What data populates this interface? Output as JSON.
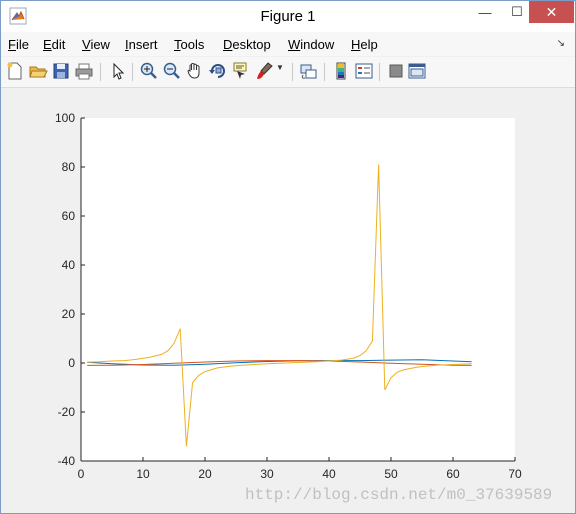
{
  "window": {
    "title": "Figure 1",
    "minimize_glyph": "—",
    "maximize_glyph": "☐",
    "close_glyph": "✕"
  },
  "menu": {
    "items": [
      {
        "label": "File",
        "mnemonic": "F",
        "rest": "ile"
      },
      {
        "label": "Edit",
        "mnemonic": "E",
        "rest": "dit"
      },
      {
        "label": "View",
        "mnemonic": "V",
        "rest": "iew"
      },
      {
        "label": "Insert",
        "mnemonic": "I",
        "rest": "nsert"
      },
      {
        "label": "Tools",
        "mnemonic": "T",
        "rest": "ools"
      },
      {
        "label": "Desktop",
        "mnemonic": "D",
        "rest": "esktop"
      },
      {
        "label": "Window",
        "mnemonic": "W",
        "rest": "indow"
      },
      {
        "label": "Help",
        "mnemonic": "H",
        "rest": "elp"
      }
    ],
    "dock_glyph": "↘"
  },
  "toolbar": {
    "icons": [
      "new-figure-icon",
      "open-file-icon",
      "save-icon",
      "print-icon",
      "edit-plot-icon",
      "zoom-in-icon",
      "zoom-out-icon",
      "pan-icon",
      "rotate-3d-icon",
      "data-cursor-icon",
      "brush-icon",
      "brush-dropdown-icon",
      "link-plot-icon",
      "insert-colorbar-icon",
      "insert-legend-icon",
      "hide-plot-tools-icon",
      "show-plot-tools-icon"
    ]
  },
  "chart_data": {
    "type": "line",
    "title": "",
    "xlabel": "",
    "ylabel": "",
    "xlim": [
      0,
      70
    ],
    "ylim": [
      -40,
      100
    ],
    "xticks": [
      0,
      10,
      20,
      30,
      40,
      50,
      60,
      70
    ],
    "yticks": [
      -40,
      -20,
      0,
      20,
      40,
      60,
      80,
      100
    ],
    "grid": false,
    "colors": {
      "blue": "#0072bd",
      "red": "#d95319",
      "yellow": "#edb120"
    },
    "series": [
      {
        "color": "#0072bd",
        "x": [
          1,
          5,
          10,
          15,
          20,
          25,
          30,
          35,
          40,
          45,
          50,
          55,
          60,
          63
        ],
        "y": [
          0.3,
          -0.3,
          -0.8,
          -0.9,
          -0.5,
          0.1,
          0.6,
          0.9,
          1.0,
          1.0,
          1.2,
          1.3,
          0.8,
          0.5
        ]
      },
      {
        "color": "#d95319",
        "x": [
          1,
          5,
          10,
          15,
          20,
          25,
          30,
          35,
          40,
          45,
          50,
          55,
          60,
          63
        ],
        "y": [
          -1.0,
          -0.9,
          -0.6,
          -0.1,
          0.4,
          0.8,
          1.0,
          1.0,
          0.8,
          0.4,
          -0.1,
          -0.5,
          -0.9,
          -1.0
        ]
      },
      {
        "color": "#edb120",
        "x": [
          1,
          3,
          5,
          7,
          9,
          11,
          13,
          14,
          15,
          16,
          17,
          18,
          19,
          20,
          22,
          24,
          26,
          28,
          30,
          32,
          34,
          36,
          38,
          40,
          42,
          44,
          45,
          46,
          47,
          48,
          49,
          50,
          51,
          52,
          54,
          56,
          58,
          60,
          62,
          63
        ],
        "y": [
          0.3,
          0.5,
          0.8,
          1.0,
          1.5,
          2.3,
          3.5,
          5.0,
          8.0,
          14.0,
          -34.0,
          -8.0,
          -5.0,
          -3.5,
          -2.0,
          -1.3,
          -0.9,
          -0.6,
          -0.3,
          -0.1,
          0.1,
          0.3,
          0.5,
          0.8,
          1.2,
          2.0,
          3.0,
          5.0,
          9.0,
          81.0,
          -11.0,
          -6.0,
          -3.8,
          -2.8,
          -1.8,
          -1.2,
          -0.8,
          -0.6,
          -0.4,
          -0.3
        ]
      }
    ]
  },
  "watermark": {
    "text": "http://blog.csdn.net/m0_37639589"
  }
}
